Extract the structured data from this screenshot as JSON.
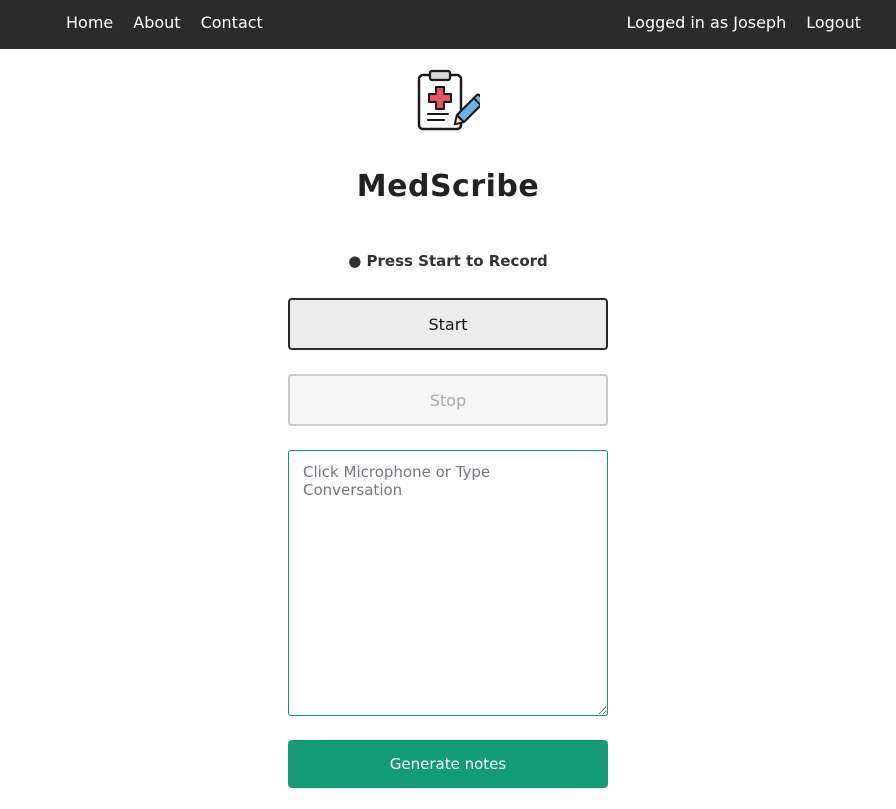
{
  "nav": {
    "home": "Home",
    "about": "About",
    "contact": "Contact",
    "user_status": "Logged in as Joseph",
    "logout": "Logout"
  },
  "app": {
    "title": "MedScribe",
    "logo_icon": "clipboard-medical-pen-icon"
  },
  "recorder": {
    "status": "● Press Start to Record",
    "start_label": "Start",
    "stop_label": "Stop"
  },
  "conversation": {
    "placeholder": "Click Microphone or Type Conversation",
    "value": ""
  },
  "actions": {
    "generate_label": "Generate notes"
  },
  "colors": {
    "navbar": "#2b2b2b",
    "accent": "#139b76",
    "input_border": "#16967a"
  }
}
